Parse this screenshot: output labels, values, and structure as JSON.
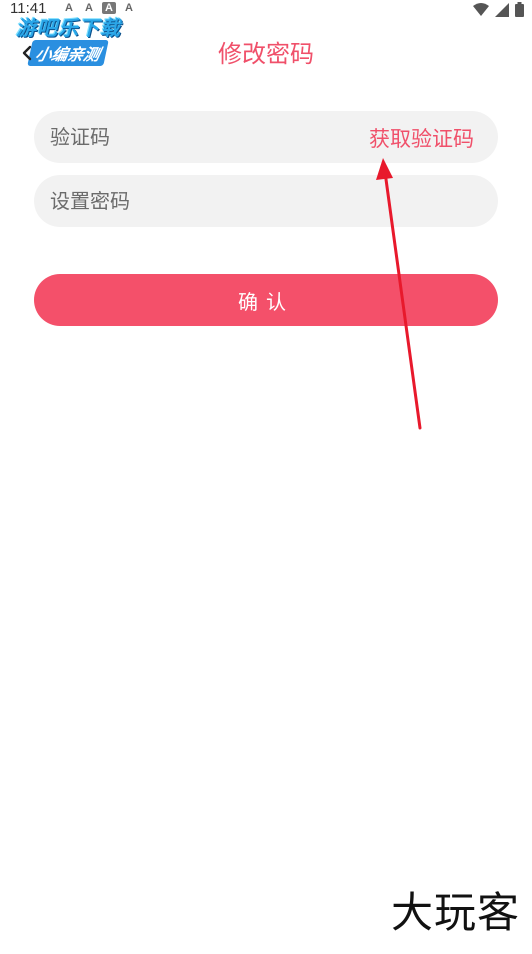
{
  "status_bar": {
    "time": "11:41",
    "notifications": [
      "A",
      "A",
      "A",
      "A"
    ]
  },
  "watermark": {
    "line1": "游吧乐下载",
    "line2": "小编亲测"
  },
  "header": {
    "title": "修改密码"
  },
  "form": {
    "code_placeholder": "验证码",
    "get_code_label": "获取验证码",
    "password_placeholder": "设置密码",
    "confirm_label": "确认"
  },
  "bottom_watermark": "大玩客",
  "colors": {
    "accent": "#f4506a",
    "field_bg": "#f2f2f2",
    "annotation": "#e8192c"
  }
}
